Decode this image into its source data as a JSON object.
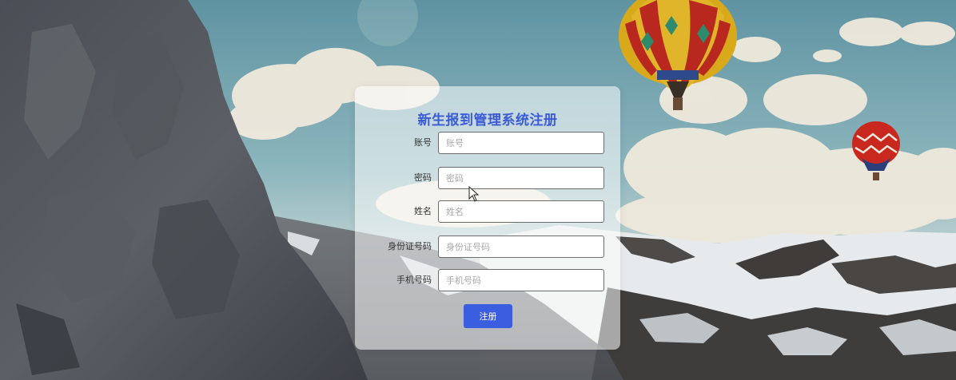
{
  "form": {
    "title": "新生报到管理系统注册",
    "fields": [
      {
        "label": "账号",
        "placeholder": "账号",
        "value": ""
      },
      {
        "label": "密码",
        "placeholder": "密码",
        "value": ""
      },
      {
        "label": "姓名",
        "placeholder": "姓名",
        "value": ""
      },
      {
        "label": "身份证号码",
        "placeholder": "身份证号码",
        "value": ""
      },
      {
        "label": "手机号码",
        "placeholder": "手机号码",
        "value": ""
      }
    ],
    "submit_label": "注册"
  },
  "colors": {
    "accent": "#3b5de0",
    "title": "#3b5bd6"
  },
  "background": {
    "icons": [
      "mountain-cliff",
      "hot-air-balloon-large",
      "hot-air-balloon-small",
      "clouds",
      "snowy-peaks"
    ]
  }
}
